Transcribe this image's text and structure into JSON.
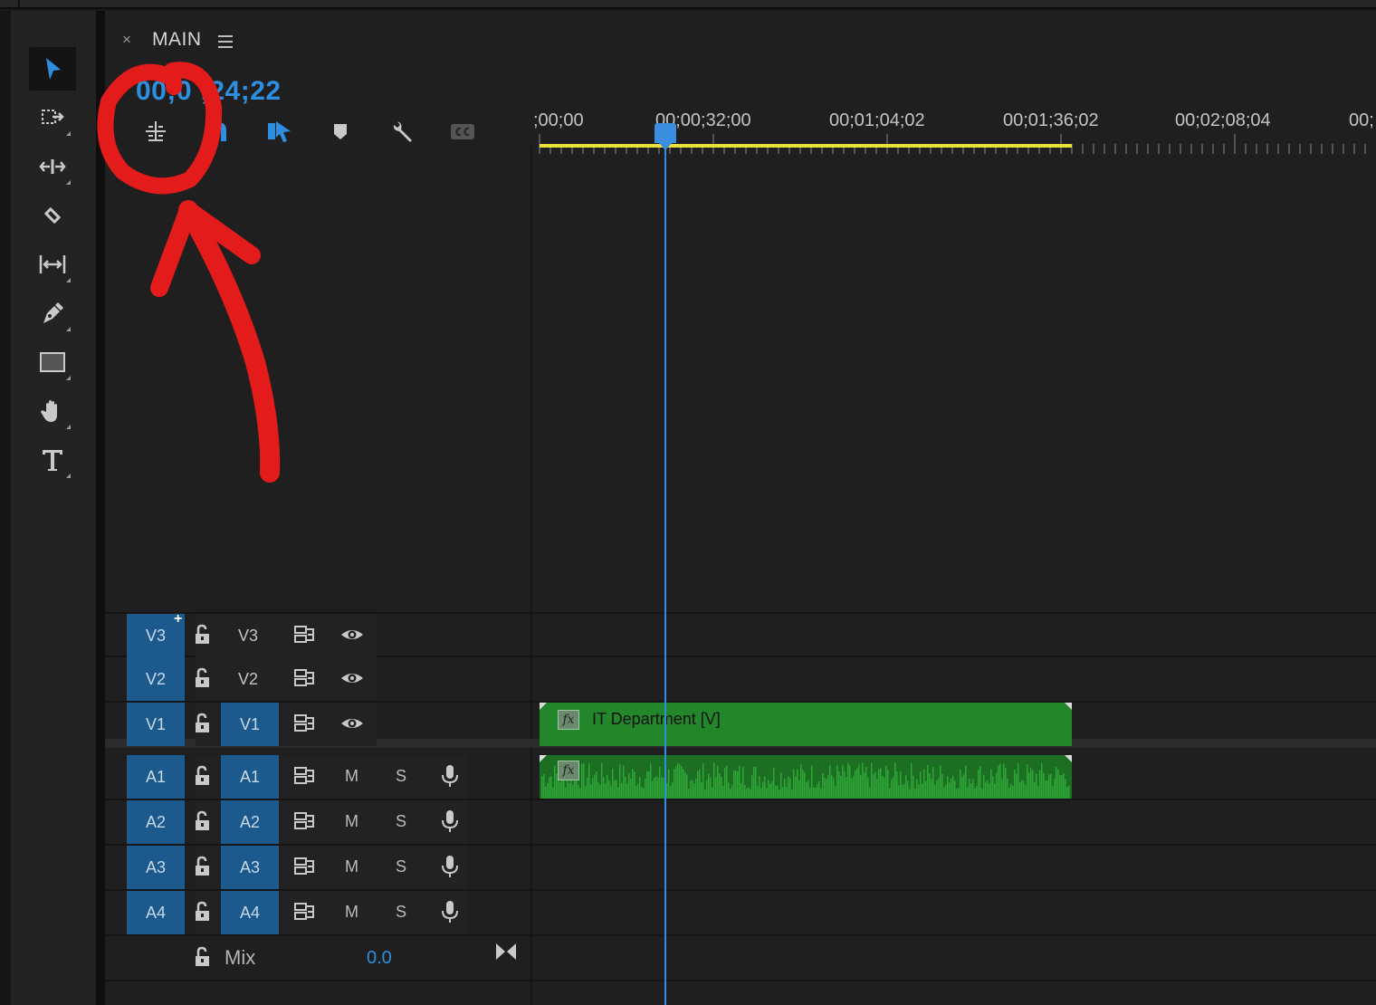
{
  "panel": {
    "close_glyph": "×",
    "sequence_name": "MAIN",
    "menu_icon": "hamburger-icon",
    "timecode": "00;0 ;24;22"
  },
  "toolbar": {
    "tools": [
      {
        "name": "selection-tool",
        "icon": "arrow-icon",
        "active": true
      },
      {
        "name": "track-select-tool",
        "icon": "track-select-icon"
      },
      {
        "name": "ripple-edit-tool",
        "icon": "ripple-edit-icon"
      },
      {
        "name": "razor-tool",
        "icon": "razor-icon"
      },
      {
        "name": "slip-tool",
        "icon": "slip-icon"
      },
      {
        "name": "pen-tool",
        "icon": "pen-icon"
      },
      {
        "name": "rectangle-tool",
        "icon": "rectangle-icon"
      },
      {
        "name": "hand-tool",
        "icon": "hand-icon"
      },
      {
        "name": "type-tool",
        "icon": "type-icon"
      }
    ]
  },
  "timeline_controls": [
    "insert-nest-icon",
    "snap-icon",
    "linked-selection-icon",
    "add-marker-icon",
    "wrench-icon",
    "captions-icon"
  ],
  "ruler": {
    "labels": [
      ";00;00",
      "00;00;32;00",
      "00;01;04;02",
      "00;01;36;02",
      "00;02;08;04",
      "00;"
    ]
  },
  "video_tracks": [
    {
      "target": "V3",
      "name": "V3"
    },
    {
      "target": "V2",
      "name": "V2"
    },
    {
      "target": "V1",
      "name": "V1"
    }
  ],
  "audio_tracks": [
    {
      "target": "A1",
      "name": "A1",
      "mute": "M",
      "solo": "S"
    },
    {
      "target": "A2",
      "name": "A2",
      "mute": "M",
      "solo": "S"
    },
    {
      "target": "A3",
      "name": "A3",
      "mute": "M",
      "solo": "S"
    },
    {
      "target": "A4",
      "name": "A4",
      "mute": "M",
      "solo": "S"
    }
  ],
  "clips": {
    "video": {
      "name": "IT Department [V]",
      "fx": "fx"
    },
    "audio": {
      "fx": "fx"
    }
  },
  "mix": {
    "label": "Mix",
    "value": "0.0"
  },
  "colors": {
    "accent": "#2e8fe0",
    "track_target": "#1c5a8e",
    "video_clip": "#24862a",
    "audio_clip": "#1b6e22",
    "work_area": "#e8e13a",
    "annotation": "#e31b1b"
  }
}
